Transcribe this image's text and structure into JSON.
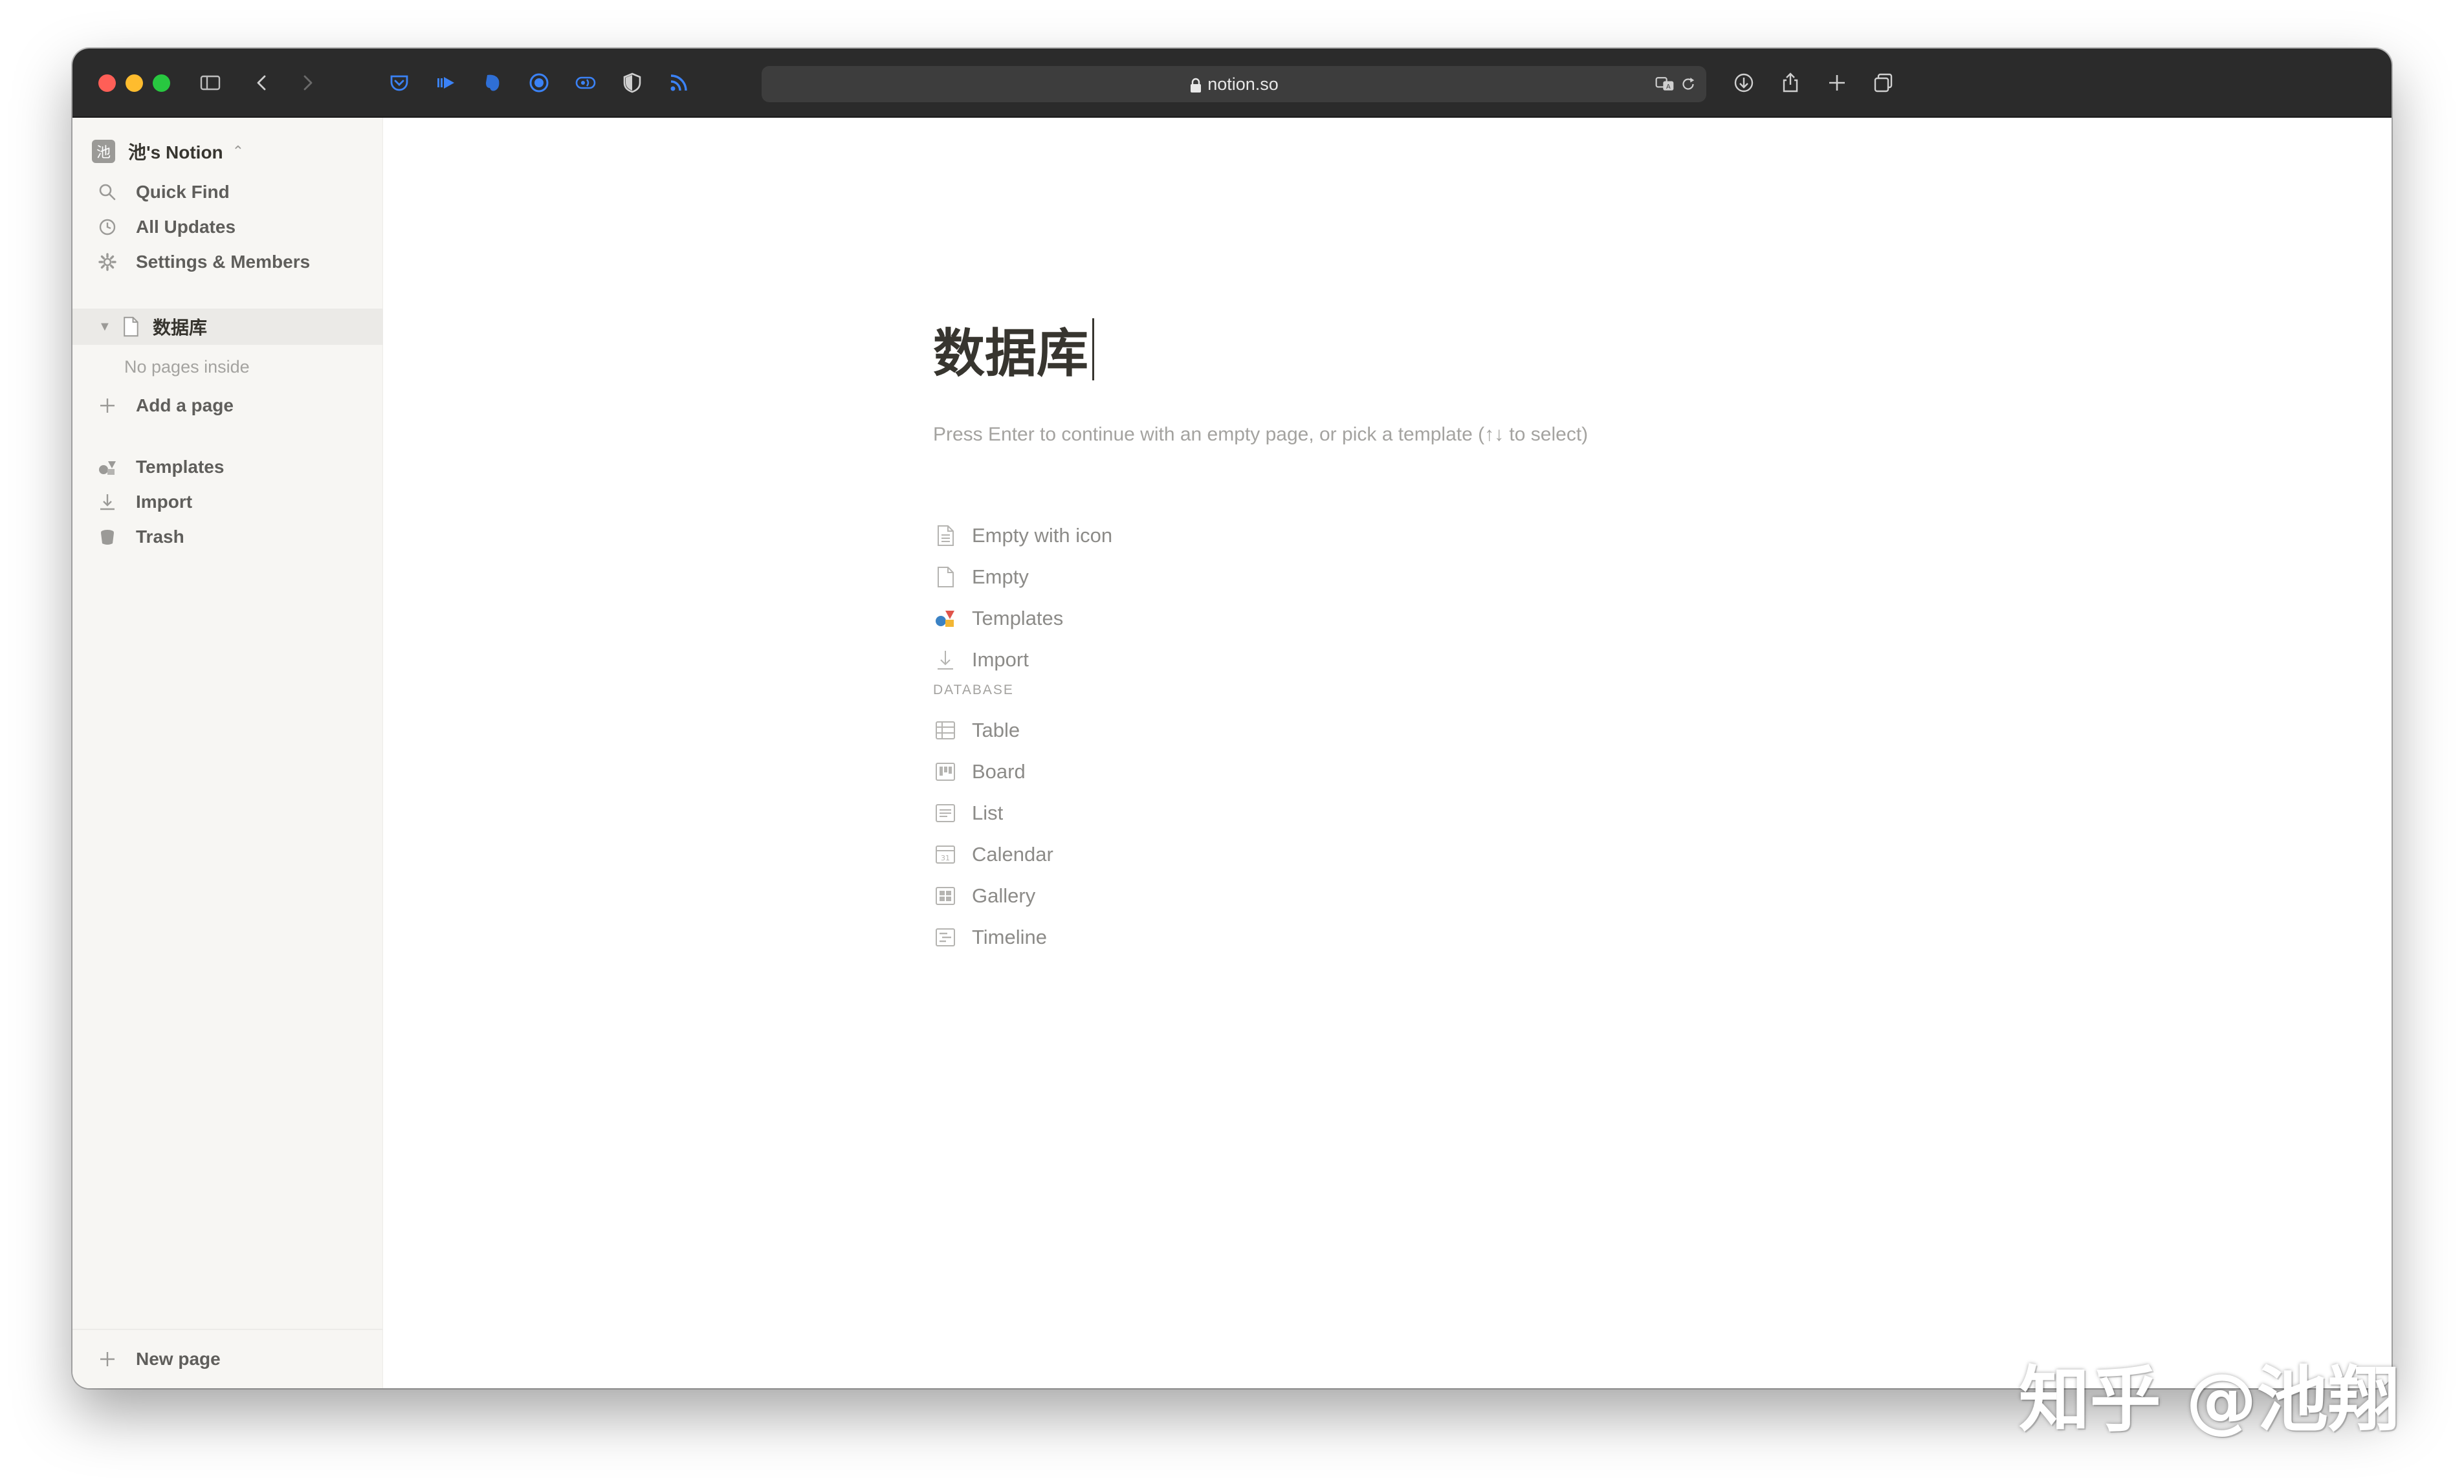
{
  "browser": {
    "url": "notion.so",
    "toolbar_icons": [
      "sidebar-toggle-icon",
      "back-icon",
      "forward-icon",
      "pocket-icon",
      "extension-play-icon",
      "evernote-icon",
      "extension-circle-icon",
      "extension-sound-icon",
      "shield-icon",
      "rss-icon",
      "translate-icon",
      "reload-icon",
      "download-icon",
      "share-icon",
      "new-tab-icon",
      "tabs-overview-icon"
    ]
  },
  "sidebar": {
    "workspace_avatar": "池",
    "workspace_name": "池's Notion",
    "quick_find": "Quick Find",
    "all_updates": "All Updates",
    "settings_members": "Settings & Members",
    "page_title": "数据库",
    "no_pages": "No pages inside",
    "add_page": "Add a page",
    "templates": "Templates",
    "import": "Import",
    "trash": "Trash",
    "new_page": "New page"
  },
  "main": {
    "title": "数据库",
    "hint": "Press Enter to continue with an empty page, or pick a template (↑↓ to select)",
    "options": {
      "empty_with_icon": "Empty with icon",
      "empty": "Empty",
      "templates": "Templates",
      "import": "Import"
    },
    "database_label": "DATABASE",
    "database_options": {
      "table": "Table",
      "board": "Board",
      "list": "List",
      "calendar": "Calendar",
      "gallery": "Gallery",
      "timeline": "Timeline"
    }
  },
  "watermark": "知乎 @池翔",
  "colors": {
    "toolbar_bg": "#2b2b2b",
    "sidebar_bg": "#f7f6f3",
    "text": "#37352f",
    "muted": "#a4a3a0",
    "extension_blue": "#3b82f6"
  }
}
